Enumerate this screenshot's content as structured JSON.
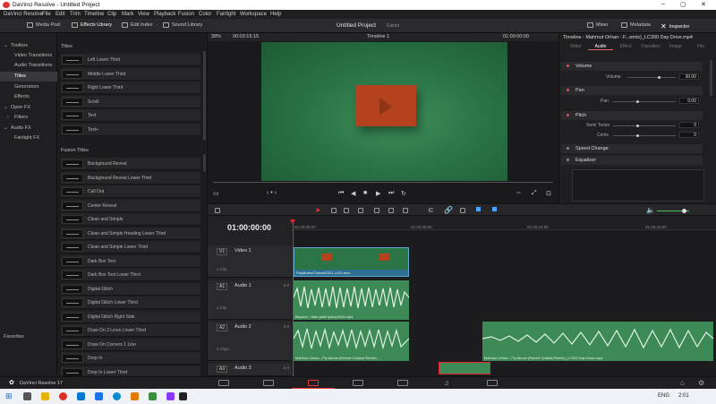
{
  "window": {
    "title": "DaVinci Resolve - Untitled Project",
    "controls": [
      "–",
      "▢",
      "✕"
    ]
  },
  "menu": [
    "DaVinci Resolve",
    "File",
    "Edit",
    "Trim",
    "Timeline",
    "Clip",
    "Mark",
    "View",
    "Playback",
    "Fusion",
    "Color",
    "Fairlight",
    "Workspace",
    "Help"
  ],
  "toolbar": {
    "media_pool": "Media Pool",
    "effects_library": "Effects Library",
    "edit_index": "Edit Index",
    "sound_library": "Sound Library",
    "project_title": "Untitled Project",
    "project_status": "Edited",
    "mixer": "Mixer",
    "metadata": "Metadata",
    "inspector": "Inspector"
  },
  "left_panel": {
    "items": [
      {
        "label": "Toolbox",
        "indent": false
      },
      {
        "label": "Video Transitions",
        "indent": true
      },
      {
        "label": "Audio Transitions",
        "indent": true
      },
      {
        "label": "Titles",
        "indent": true
      },
      {
        "label": "Generators",
        "indent": true
      },
      {
        "label": "Effects",
        "indent": true
      },
      {
        "label": "Open FX",
        "indent": false
      },
      {
        "label": "Filters",
        "indent": true
      },
      {
        "label": "Audio FX",
        "indent": false
      },
      {
        "label": "Fairlight FX",
        "indent": true
      }
    ],
    "favorites": "Favorites"
  },
  "effects": {
    "titles_header": "Titles",
    "titles": [
      "Left Lower Third",
      "Middle Lower Third",
      "Right Lower Third",
      "Scroll",
      "Text",
      "Text+"
    ],
    "fusion_header": "Fusion Titles",
    "fusion_titles": [
      "Background Reveal",
      "Background Reveal Lower Third",
      "Call Out",
      "Center Reveal",
      "Clean and Simple",
      "Clean and Simple Heading Lower Third",
      "Clean and Simple Lower Third",
      "Dark Box Text",
      "Dark Box Text Lower Third",
      "Digital Glitch",
      "Digital Glitch Lower Third",
      "Digital Glitch Right Side",
      "Draw On 2 Lines Lower Third",
      "Draw On Corners 1 Line",
      "Drop In",
      "Drop In Lower Third"
    ]
  },
  "viewer": {
    "zoom": "39%",
    "timecode_left": "00:03:15:15",
    "timeline_name": "Timeline 1",
    "timecode_right": "01:00:00:00"
  },
  "inspector": {
    "header": "Timeline - Mahmut Orhan - F...emix)_LC300 Day Drive.mp4",
    "tabs": [
      "Video",
      "Audio",
      "Effect",
      "Transition",
      "Image",
      "File"
    ],
    "active_tab": "Audio",
    "volume": {
      "label": "Volume",
      "param": "Volume",
      "value": "30.00"
    },
    "pan": {
      "label": "Pan",
      "param": "Pan",
      "value": "0.00"
    },
    "pitch": {
      "label": "Pitch",
      "semi_label": "Semi Tones",
      "semi_value": "0",
      "cents_label": "Cents",
      "cents_value": "0"
    },
    "speed_change": "Speed Change",
    "equalizer": "Equalizer"
  },
  "timeline": {
    "timecode": "01:00:00:00",
    "ruler": [
      "01:00:00:00",
      "01:00:08:00",
      "01:00:16:00",
      "01:00:24:00",
      "01:00:32:00"
    ],
    "tracks": [
      {
        "id": "V1",
        "name": "Video 1",
        "clips": "1 Clip",
        "ch": ""
      },
      {
        "id": "A1",
        "name": "Audio 1",
        "clips": "1 Clip",
        "ch": "2.0"
      },
      {
        "id": "A2",
        "name": "Audio 2",
        "clips": "2 Clips",
        "ch": "2.0"
      },
      {
        "id": "A3",
        "name": "Audio 3",
        "clips": "",
        "ch": "2.0"
      }
    ],
    "video_clip": "PlayButtonTutorial2021-1420.mov",
    "audio1_clip": "Beyond - Halo (with lyrics)2020.mp4",
    "audio2_clip_a": "Mahmut Orhan - Fly Above (Robert Cristian Remix) ...",
    "audio2_clip_b": "Mahmut Orhan - Fly Above (Robert Cristian Remix)_LC300 Day Drive.mp4"
  },
  "statusbar": {
    "app": "DaVinci Resolve 17"
  },
  "taskbar": {
    "lang": "ENG",
    "time": "2:01"
  },
  "colors": {
    "accent_red": "#e23333",
    "clip_green": "#3e8a57"
  }
}
